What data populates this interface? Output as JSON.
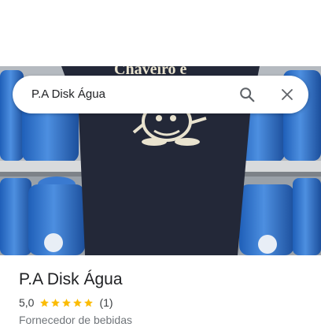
{
  "search": {
    "query": "P.A Disk Água"
  },
  "photo": {
    "shirt_text": "Chaveiro e"
  },
  "place": {
    "name": "P.A Disk Água",
    "rating_value": "5,0",
    "rating_stars": 5,
    "review_count": "(1)",
    "category": "Fornecedor de bebidas"
  },
  "colors": {
    "star": "#fbbc04",
    "title": "#202124",
    "secondary": "#70757a",
    "shirt": "#232838"
  },
  "icons": {
    "search": "search-icon",
    "close": "close-icon",
    "star": "star-icon"
  }
}
